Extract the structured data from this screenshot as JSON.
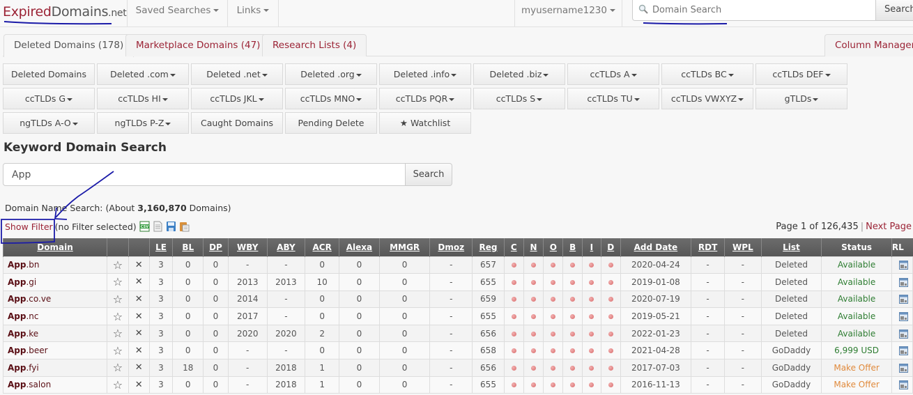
{
  "navbar": {
    "brand": {
      "part1": "Expired",
      "part2": "Domains",
      "part3": ".net"
    },
    "items": [
      {
        "label": "Saved Searches",
        "icon": "caret-down-icon"
      },
      {
        "label": "Links",
        "icon": "caret-down-icon"
      },
      {
        "label": "myusername1230",
        "icon": "caret-down-icon"
      }
    ],
    "search": {
      "placeholder": "Domain Search",
      "icon": "search-icon",
      "button_label": "Search"
    }
  },
  "tabs": [
    {
      "label": "Deleted Domains (178)",
      "active": true
    },
    {
      "label": "Marketplace Domains (47)",
      "active": false
    },
    {
      "label": "Research Lists (4)",
      "active": false
    }
  ],
  "column_manager_label": "Column Manager",
  "category_buttons": [
    [
      {
        "label": "Deleted Domains",
        "dropdown": false
      },
      {
        "label": "Deleted .com",
        "dropdown": true
      },
      {
        "label": "Deleted .net",
        "dropdown": true
      },
      {
        "label": "Deleted .org",
        "dropdown": true
      },
      {
        "label": "Deleted .info",
        "dropdown": true
      },
      {
        "label": "Deleted .biz",
        "dropdown": true
      },
      {
        "label": "ccTLDs A",
        "dropdown": true
      },
      {
        "label": "ccTLDs BC",
        "dropdown": true
      },
      {
        "label": "ccTLDs DEF",
        "dropdown": true
      }
    ],
    [
      {
        "label": "ccTLDs G",
        "dropdown": true
      },
      {
        "label": "ccTLDs HI",
        "dropdown": true
      },
      {
        "label": "ccTLDs JKL",
        "dropdown": true
      },
      {
        "label": "ccTLDs MNO",
        "dropdown": true
      },
      {
        "label": "ccTLDs PQR",
        "dropdown": true
      },
      {
        "label": "ccTLDs S",
        "dropdown": true
      },
      {
        "label": "ccTLDs TU",
        "dropdown": true
      },
      {
        "label": "ccTLDs VWXYZ",
        "dropdown": true
      },
      {
        "label": "gTLDs",
        "dropdown": true
      }
    ],
    [
      {
        "label": "ngTLDs A-O",
        "dropdown": true
      },
      {
        "label": "ngTLDs P-Z",
        "dropdown": true
      },
      {
        "label": "Caught Domains",
        "dropdown": false
      },
      {
        "label": "Pending Delete",
        "dropdown": false
      },
      {
        "label": "★ Watchlist",
        "dropdown": false
      }
    ]
  ],
  "keyword_search": {
    "title": "Keyword Domain Search",
    "value": "App",
    "button_label": "Search"
  },
  "summary": {
    "prefix": "Domain Name Search: (About ",
    "count": "3,160,870",
    "suffix": " Domains)"
  },
  "filter": {
    "show_filter_label": "Show Filter",
    "status": "(no Filter selected)",
    "export_icons": [
      "csv-icon",
      "text-file-icon",
      "save-icon",
      "clipboard-icon"
    ]
  },
  "pager": {
    "text": "Page 1 of 126,435",
    "separator": "|",
    "next_label": "Next Page"
  },
  "table": {
    "columns": [
      "Domain",
      "",
      "",
      "LE",
      "BL",
      "DP",
      "WBY",
      "ABY",
      "ACR",
      "Alexa",
      "MMGR",
      "Dmoz",
      "Reg",
      "C",
      "N",
      "O",
      "B",
      "I",
      "D",
      "Add Date",
      "RDT",
      "WPL",
      "List",
      "Status",
      "RL"
    ],
    "rows": [
      {
        "keyword": "App",
        "tld": ".bn",
        "le": "3",
        "bl": "0",
        "dp": "0",
        "wby": "-",
        "aby": "-",
        "acr": "0",
        "alexa": "0",
        "mmgr": "0",
        "dmoz": "-",
        "reg": "657",
        "add_date": "2020-04-24",
        "rdt": "-",
        "wpl": "-",
        "list": "Deleted",
        "status": "Available",
        "status_type": "available"
      },
      {
        "keyword": "App",
        "tld": ".gi",
        "le": "3",
        "bl": "0",
        "dp": "0",
        "wby": "2013",
        "aby": "2013",
        "acr": "10",
        "alexa": "0",
        "mmgr": "0",
        "dmoz": "-",
        "reg": "655",
        "add_date": "2019-01-08",
        "rdt": "-",
        "wpl": "-",
        "list": "Deleted",
        "status": "Available",
        "status_type": "available"
      },
      {
        "keyword": "App",
        "tld": ".co.ve",
        "le": "3",
        "bl": "0",
        "dp": "0",
        "wby": "2014",
        "aby": "-",
        "acr": "0",
        "alexa": "0",
        "mmgr": "0",
        "dmoz": "-",
        "reg": "659",
        "add_date": "2020-07-19",
        "rdt": "-",
        "wpl": "-",
        "list": "Deleted",
        "status": "Available",
        "status_type": "available"
      },
      {
        "keyword": "App",
        "tld": ".nc",
        "le": "3",
        "bl": "0",
        "dp": "0",
        "wby": "2017",
        "aby": "-",
        "acr": "0",
        "alexa": "0",
        "mmgr": "0",
        "dmoz": "-",
        "reg": "655",
        "add_date": "2019-05-21",
        "rdt": "-",
        "wpl": "-",
        "list": "Deleted",
        "status": "Available",
        "status_type": "available"
      },
      {
        "keyword": "App",
        "tld": ".ke",
        "le": "3",
        "bl": "0",
        "dp": "0",
        "wby": "2020",
        "aby": "2020",
        "acr": "2",
        "alexa": "0",
        "mmgr": "0",
        "dmoz": "-",
        "reg": "656",
        "add_date": "2022-01-23",
        "rdt": "-",
        "wpl": "-",
        "list": "Deleted",
        "status": "Available",
        "status_type": "available"
      },
      {
        "keyword": "App",
        "tld": ".beer",
        "le": "3",
        "bl": "0",
        "dp": "0",
        "wby": "-",
        "aby": "-",
        "acr": "0",
        "alexa": "0",
        "mmgr": "0",
        "dmoz": "-",
        "reg": "658",
        "add_date": "2021-04-28",
        "rdt": "-",
        "wpl": "-",
        "list": "GoDaddy",
        "status": "6,999 USD",
        "status_type": "price"
      },
      {
        "keyword": "App",
        "tld": ".fyi",
        "le": "3",
        "bl": "18",
        "dp": "0",
        "wby": "-",
        "aby": "2018",
        "acr": "1",
        "alexa": "0",
        "mmgr": "0",
        "dmoz": "-",
        "reg": "656",
        "add_date": "2017-07-03",
        "rdt": "-",
        "wpl": "-",
        "list": "GoDaddy",
        "status": "Make Offer",
        "status_type": "offer"
      },
      {
        "keyword": "App",
        "tld": ".salon",
        "le": "3",
        "bl": "0",
        "dp": "0",
        "wby": "-",
        "aby": "2018",
        "acr": "1",
        "alexa": "0",
        "mmgr": "0",
        "dmoz": "-",
        "reg": "655",
        "add_date": "2016-11-13",
        "rdt": "-",
        "wpl": "-",
        "list": "GoDaddy",
        "status": "Make Offer",
        "status_type": "offer"
      }
    ],
    "row_icons": {
      "watch": "star-outline-icon",
      "hide": "x-icon",
      "indicator": "red-dot-icon",
      "rl": "registrar-lookup-icon"
    }
  },
  "colors": {
    "brand_accent": "#9b2335",
    "header_bg": "#616161",
    "status_available": "#2e7d32",
    "status_offer": "#e08a3c",
    "annotation": "#1a1aa8"
  }
}
